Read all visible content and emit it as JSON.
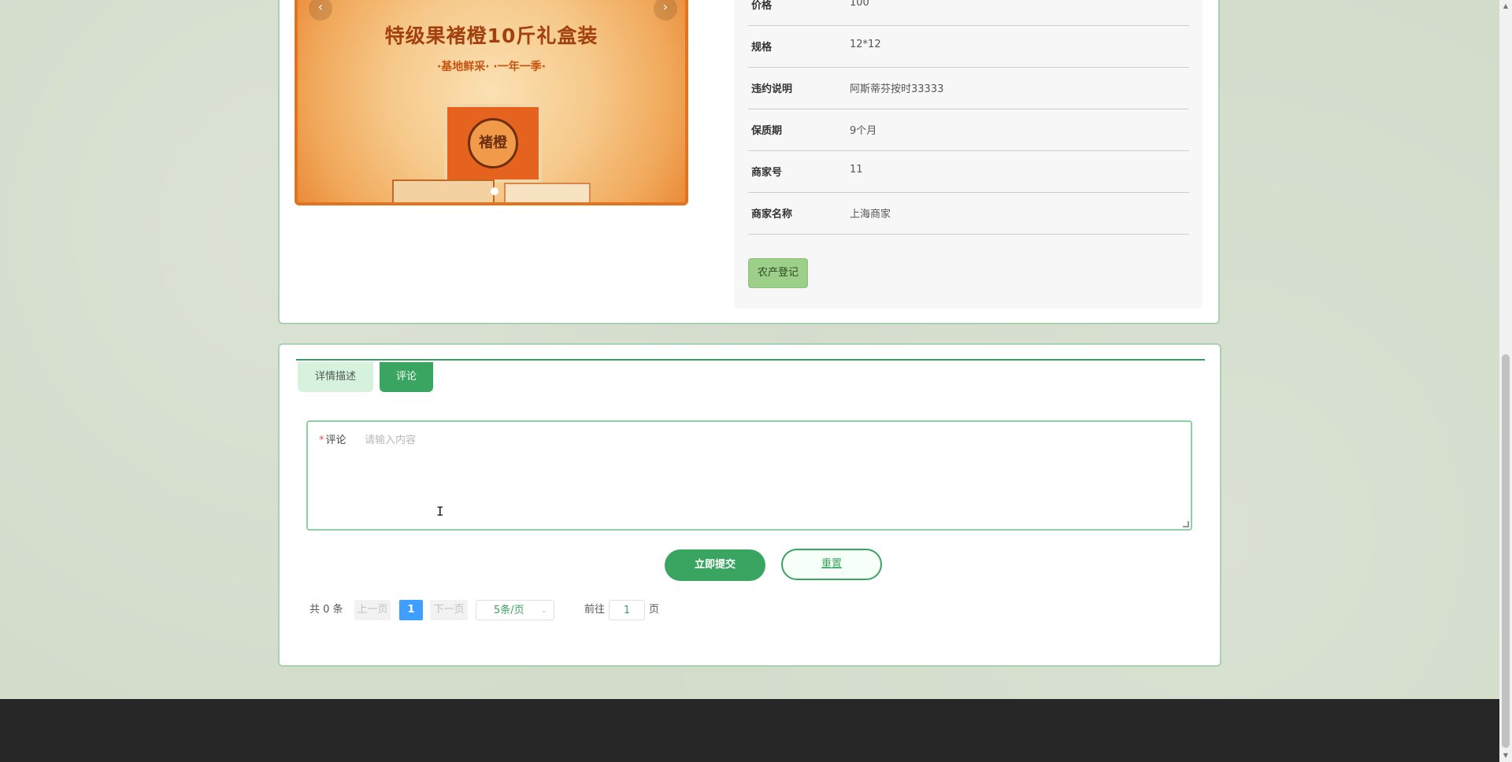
{
  "carousel": {
    "title": "特级果褚橙10斤礼盒装",
    "subtitle": "·基地鲜采·  ·一年一季·",
    "box_label": "褚橙",
    "prev_icon": "‹",
    "next_icon": "›"
  },
  "info": {
    "rows": [
      {
        "label": "价格",
        "value": "100"
      },
      {
        "label": "规格",
        "value": "12*12"
      },
      {
        "label": "违约说明",
        "value": "阿斯蒂芬按时33333"
      },
      {
        "label": "保质期",
        "value": "9个月"
      },
      {
        "label": "商家号",
        "value": "11"
      },
      {
        "label": "商家名称",
        "value": "上海商家"
      }
    ],
    "register_button": "农产登记"
  },
  "tabs": {
    "detail": "详情描述",
    "comment": "评论"
  },
  "comment_form": {
    "required_mark": "*",
    "label": "评论",
    "placeholder": "请输入内容",
    "submit": "立即提交",
    "reset": "重置"
  },
  "pagination": {
    "total": "共 0 条",
    "prev": "上一页",
    "current_page": "1",
    "next": "下一页",
    "page_size": "5条/页",
    "goto_prefix": "前往",
    "goto_value": "1",
    "goto_suffix": "页"
  },
  "colors": {
    "accent": "#3aa560",
    "page_active": "#409eff",
    "footer": "#272727"
  }
}
